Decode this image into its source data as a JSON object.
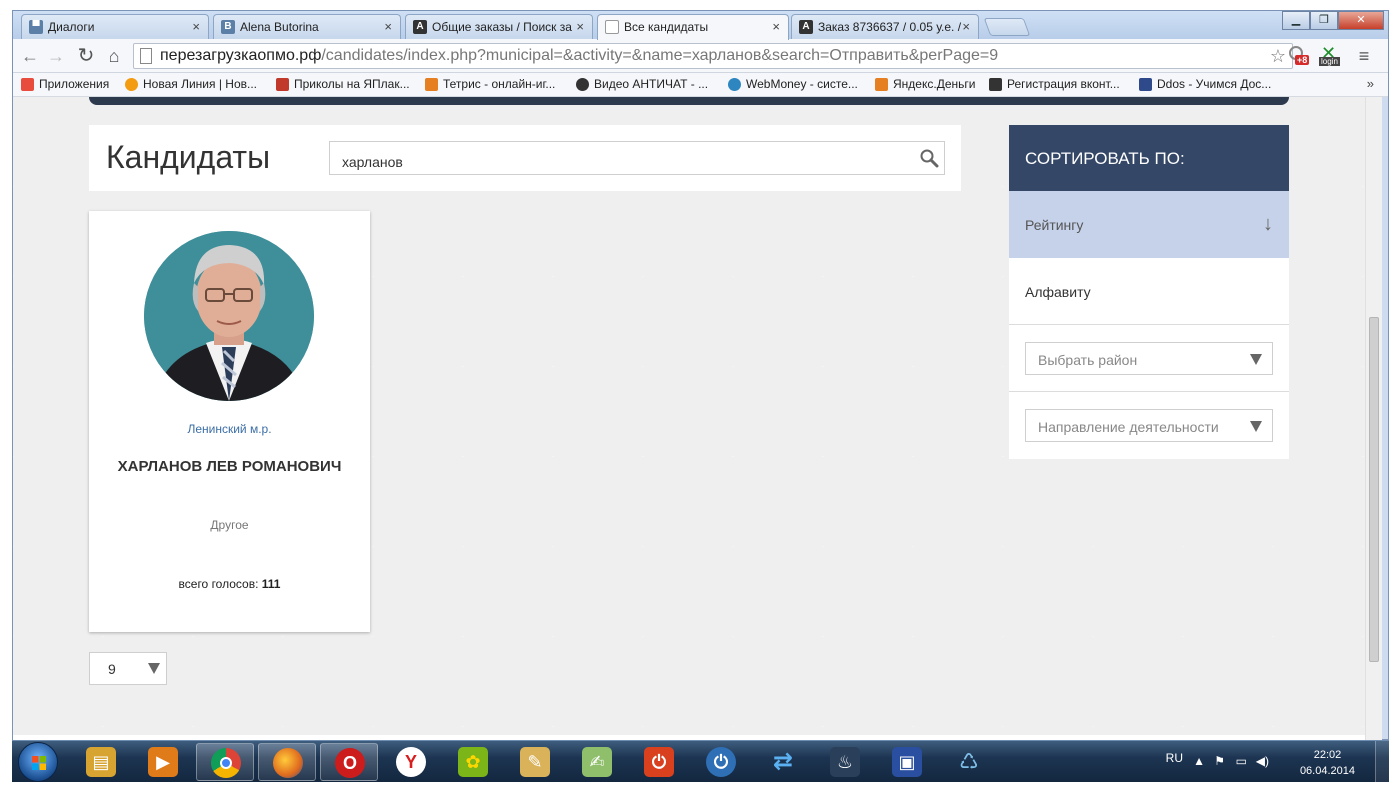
{
  "browser": {
    "tabs": [
      {
        "title": "Диалоги",
        "icon": "vk-icon",
        "color": "#5b7fa6"
      },
      {
        "title": "Alena Butorina",
        "icon": "vk-icon",
        "color": "#5b7fa6"
      },
      {
        "title": "Общие заказы / Поиск за",
        "icon": "advego-icon",
        "color": "#333333"
      },
      {
        "title": "Все кандидаты",
        "icon": "page-icon",
        "color": "#ffffff"
      },
      {
        "title": "Заказ 8736637 / 0.05 у.е. /",
        "icon": "advego-icon",
        "color": "#333333"
      }
    ],
    "tab_close_glyph": "×",
    "url_host": "перезагрузкаопмо.рф",
    "url_path": "/candidates/index.php?municipal=&activity=&name=харланов&search=Отправить&perPage=9",
    "ext_badge": "+8",
    "ext_login": "login",
    "bookmarks": [
      {
        "label": "Приложения",
        "color": "#e74c3c"
      },
      {
        "label": "Новая Линия | Нов...",
        "color": "#f39c12"
      },
      {
        "label": "Приколы на ЯПлак...",
        "color": "#c0392b"
      },
      {
        "label": "Тетрис - онлайн-иг...",
        "color": "#e67e22"
      },
      {
        "label": "Видео АНТИЧАТ - ...",
        "color": "#333333"
      },
      {
        "label": "WebMoney - систе...",
        "color": "#2e86c1"
      },
      {
        "label": "Яндекс.Деньги",
        "color": "#e67e22"
      },
      {
        "label": "Регистрация вконт...",
        "color": "#333333"
      },
      {
        "label": "Ddos - Учимся Дос...",
        "color": "#2e4a8b"
      }
    ],
    "bookmarks_more": "»"
  },
  "page": {
    "title": "Кандидаты",
    "search_value": "харланов",
    "candidate": {
      "district": "Ленинский м.р.",
      "name": "ХАРЛАНОВ ЛЕВ РОМАНОВИЧ",
      "category": "Другое",
      "votes_label": "всего голосов:",
      "votes": "111"
    },
    "per_page": "9",
    "sidebar": {
      "sort_heading": "СОРТИРОВАТЬ ПО:",
      "sort_options": [
        "Рейтингу",
        "Алфавиту"
      ],
      "sort_active": "Рейтингу",
      "sort_arrow": "↓",
      "district_placeholder": "Выбрать район",
      "activity_placeholder": "Направление деятельности"
    }
  },
  "taskbar": {
    "apps": [
      {
        "name": "explorer",
        "color": "#d8a431"
      },
      {
        "name": "media-player",
        "color": "#e07b1a"
      },
      {
        "name": "chrome",
        "color": "#3a8c3a"
      },
      {
        "name": "firefox",
        "color": "#e06a1e"
      },
      {
        "name": "opera",
        "color": "#cc1c1c"
      },
      {
        "name": "yandex-browser",
        "color": "#d81e1e"
      },
      {
        "name": "icq",
        "color": "#7cb518"
      },
      {
        "name": "paint",
        "color": "#d9b25a"
      },
      {
        "name": "notepad",
        "color": "#8fbf6b"
      },
      {
        "name": "power-app",
        "color": "#d9411e"
      },
      {
        "name": "shutdown-app",
        "color": "#2f6fb5"
      },
      {
        "name": "sync-app",
        "color": "#2f8fd0"
      },
      {
        "name": "steam",
        "color": "#2a3f5a"
      },
      {
        "name": "save-app",
        "color": "#2a4fa0"
      },
      {
        "name": "network-app",
        "color": "#3a7fc0"
      }
    ],
    "lang": "RU",
    "time": "22:02",
    "date": "06.04.2014"
  }
}
